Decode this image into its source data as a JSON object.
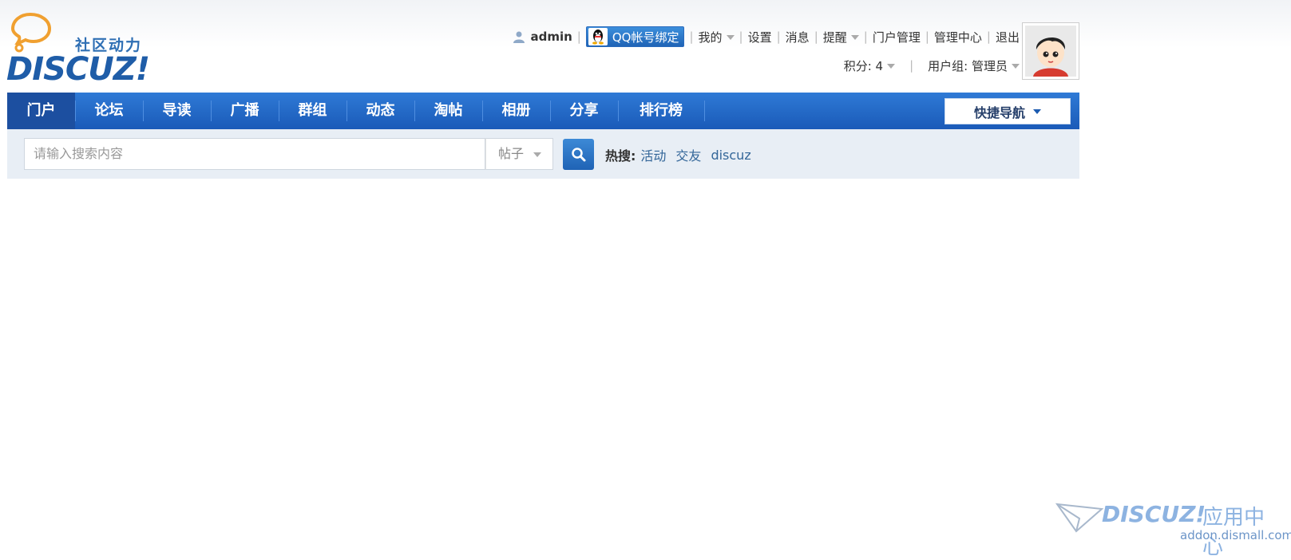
{
  "header": {
    "logo_slogan": "社区动力",
    "logo_word": "DISCUZ!"
  },
  "userbar": {
    "username": "admin",
    "qq_bind": "QQ帐号绑定",
    "links": [
      {
        "label": "我的",
        "dropdown": true
      },
      {
        "label": "设置",
        "dropdown": false
      },
      {
        "label": "消息",
        "dropdown": false
      },
      {
        "label": "提醒",
        "dropdown": true
      },
      {
        "label": "门户管理",
        "dropdown": false
      },
      {
        "label": "管理中心",
        "dropdown": false
      },
      {
        "label": "退出",
        "dropdown": false
      }
    ],
    "credits": "积分: 4",
    "usergroup": "用户组: 管理员"
  },
  "nav": {
    "items": [
      "门户",
      "论坛",
      "导读",
      "广播",
      "群组",
      "动态",
      "淘帖",
      "相册",
      "分享",
      "排行榜"
    ],
    "active_index": 0,
    "quick_nav": "快捷导航"
  },
  "search": {
    "placeholder": "请输入搜索内容",
    "type": "帖子",
    "hot_label": "热搜:",
    "hot_links": [
      "活动",
      "交友",
      "discuz"
    ]
  },
  "watermark": {
    "word": "DISCUZ!",
    "app": "应用中心",
    "url": "addon.dismall.com"
  },
  "colors": {
    "nav_bg": "#1f64b6",
    "nav_active": "#1c4fa0",
    "link": "#336699",
    "search_bg": "#e8eef5"
  }
}
